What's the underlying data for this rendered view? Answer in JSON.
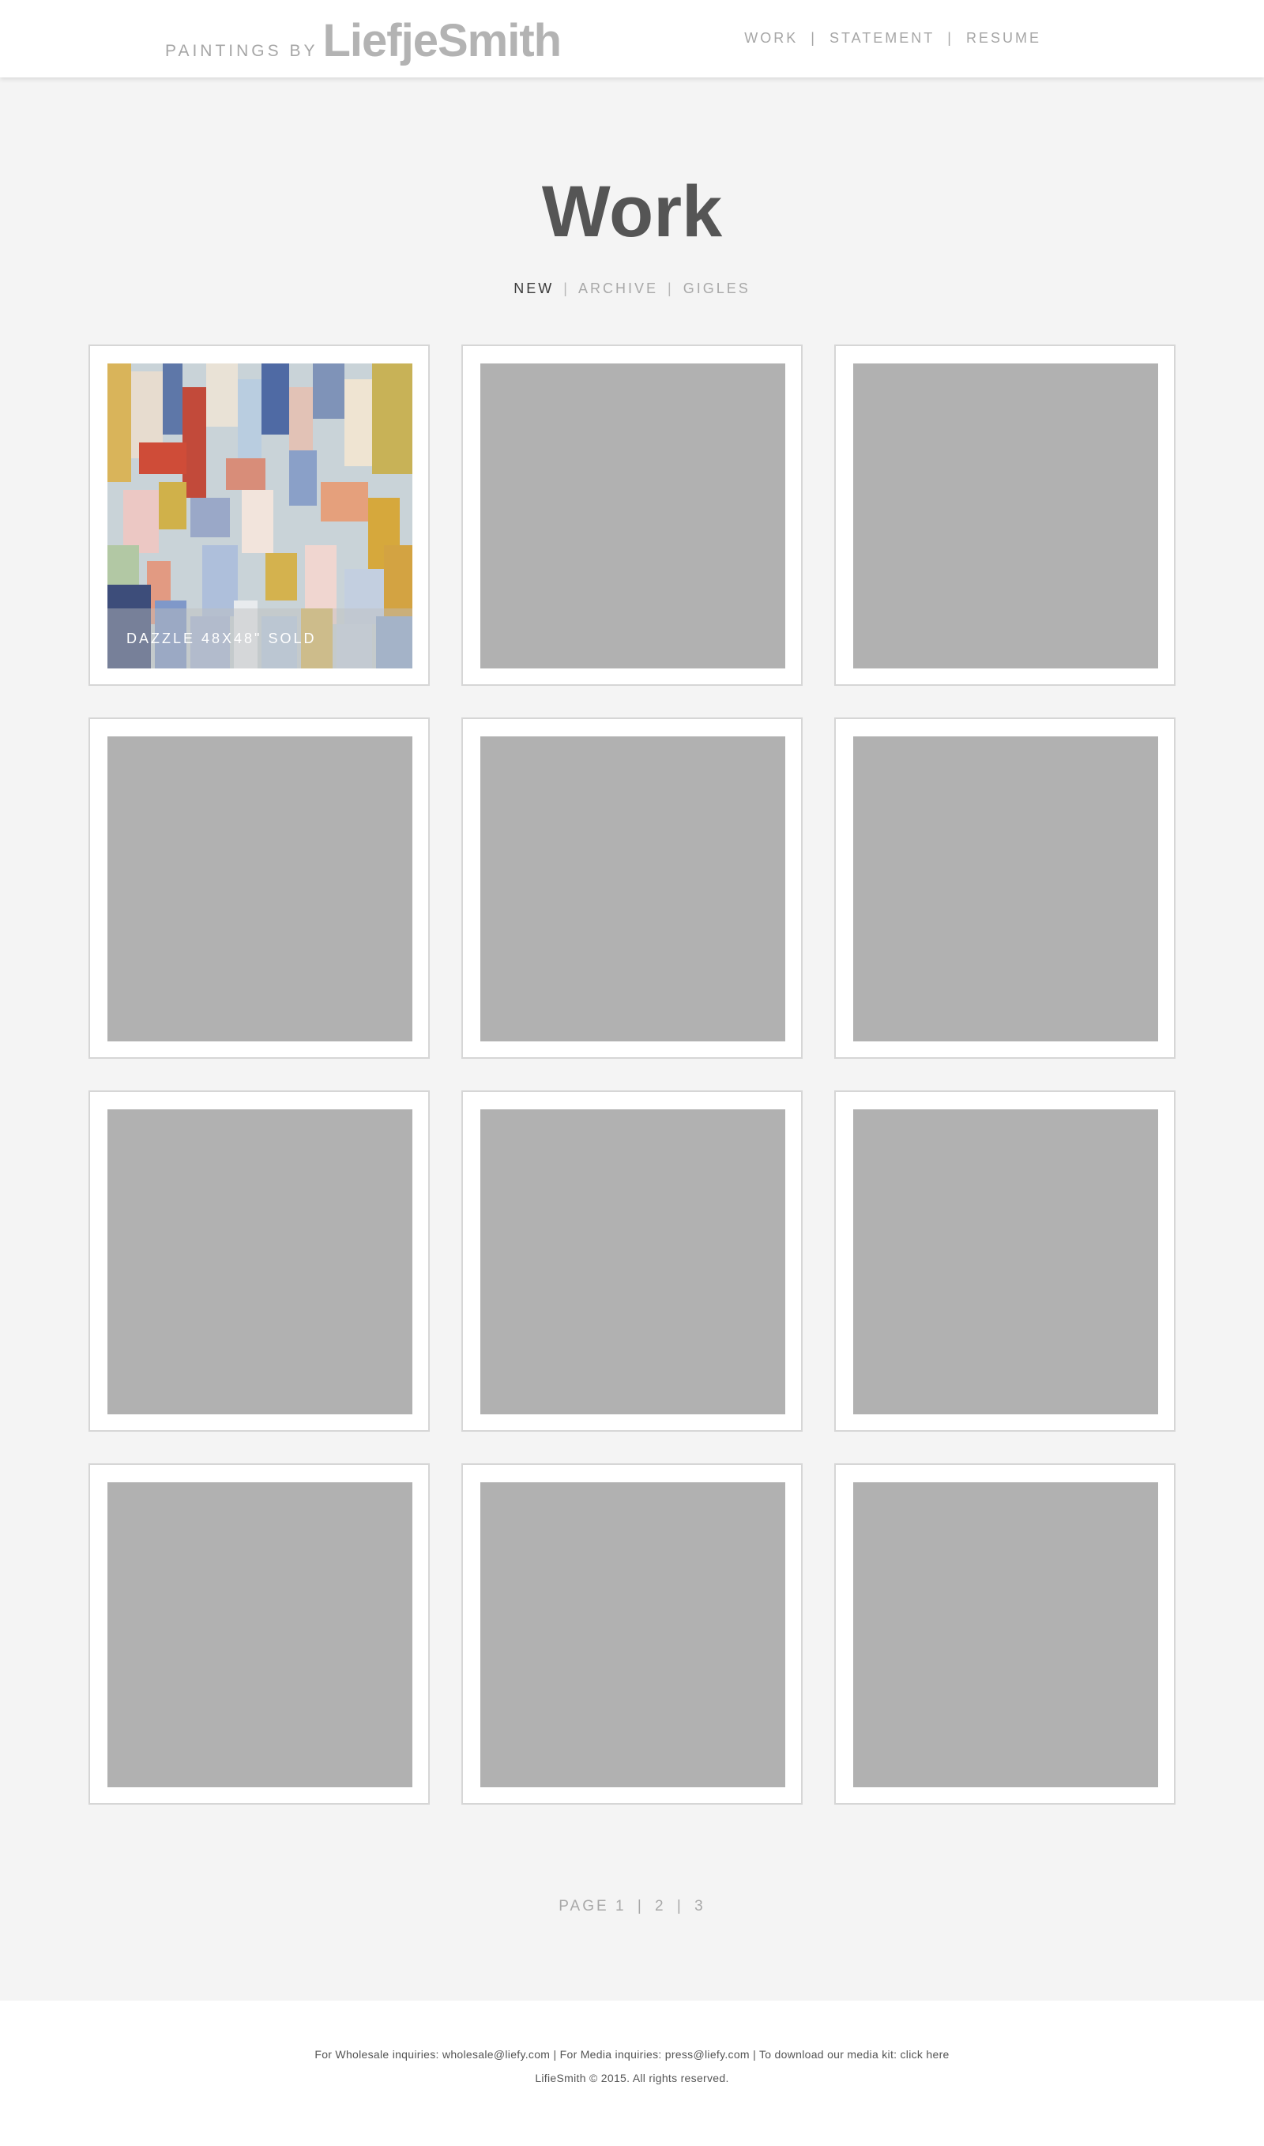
{
  "header": {
    "brand_prefix": "PAINTINGS BY",
    "brand_name": "LiefjeSmith",
    "nav": [
      {
        "label": "WORK"
      },
      {
        "label": "STATEMENT"
      },
      {
        "label": "RESUME"
      }
    ],
    "nav_separator": "|"
  },
  "main": {
    "title": "Work",
    "subnav": [
      {
        "label": "NEW",
        "active": true
      },
      {
        "label": "ARCHIVE",
        "active": false
      },
      {
        "label": "GIGLES",
        "active": false
      }
    ],
    "subnav_separator": "|",
    "gallery": {
      "placeholder_color": "#b1b1b1",
      "items": [
        {
          "caption": "DAZZLE 48X48\" SOLD",
          "has_image": true
        },
        {
          "caption": "",
          "has_image": false
        },
        {
          "caption": "",
          "has_image": false
        },
        {
          "caption": "",
          "has_image": false
        },
        {
          "caption": "",
          "has_image": false
        },
        {
          "caption": "",
          "has_image": false
        },
        {
          "caption": "",
          "has_image": false
        },
        {
          "caption": "",
          "has_image": false
        },
        {
          "caption": "",
          "has_image": false
        },
        {
          "caption": "",
          "has_image": false
        },
        {
          "caption": "",
          "has_image": false
        },
        {
          "caption": "",
          "has_image": false
        }
      ]
    }
  },
  "pagination": {
    "label": "PAGE",
    "pages": [
      "1",
      "2",
      "3"
    ],
    "separator": "|"
  },
  "footer": {
    "wholesale_text": "For Wholesale inquiries: wholesale@liefy.com",
    "media_text": "For Media inquiries: press@liefy.com",
    "mediakit_text": "To download our media kit: click here",
    "separator": "|",
    "copyright": "LifieSmith ©  2015.  All rights reserved."
  },
  "colors": {
    "page_background": "#f4f4f4",
    "header_background": "#ffffff",
    "title": "#555555",
    "muted": "#a8a8a8",
    "active_subnav": "#3a3a3a"
  }
}
